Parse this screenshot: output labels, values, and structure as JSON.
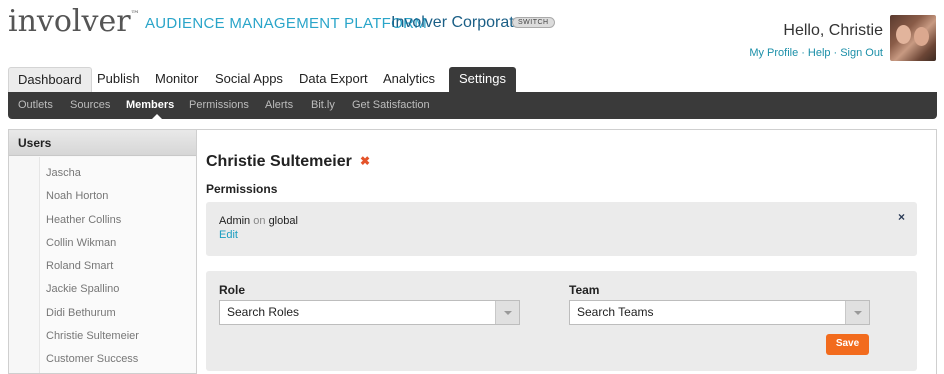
{
  "header": {
    "logo": "involver",
    "logo_tm": "™",
    "tagline": "AUDIENCE MANAGEMENT PLATFORM",
    "org_name": "Involver Corporate",
    "switch_label": "SWITCH",
    "greeting": "Hello, Christie",
    "links": [
      "My Profile",
      "Help",
      "Sign Out"
    ],
    "link_separator": "·"
  },
  "main_tabs": [
    "Dashboard",
    "Publish",
    "Monitor",
    "Social Apps",
    "Data Export",
    "Analytics",
    "Settings"
  ],
  "active_main_tab": "Settings",
  "sub_nav": [
    "Outlets",
    "Sources",
    "Members",
    "Permissions",
    "Alerts",
    "Bit.ly",
    "Get Satisfaction"
  ],
  "active_sub_nav": "Members",
  "users_panel": {
    "title": "Users",
    "users": [
      "Jascha",
      "Noah Horton",
      "Heather Collins",
      "Collin Wikman",
      "Roland Smart",
      "Jackie Spallino",
      "Didi Bethurum",
      "Christie Sultemeier",
      "Customer Success"
    ]
  },
  "content": {
    "user_name": "Christie Sultemeier",
    "delete_icon": "✖",
    "permissions_heading": "Permissions",
    "permission": {
      "role": "Admin",
      "connector": "on",
      "scope": "global",
      "edit_label": "Edit",
      "remove_icon": "×"
    },
    "form": {
      "role_label": "Role",
      "role_placeholder": "Search Roles",
      "team_label": "Team",
      "team_placeholder": "Search Teams",
      "save_label": "Save"
    }
  },
  "colors": {
    "accent_teal": "#2aa5c9",
    "nav_dark": "#3a3a3a",
    "save_orange": "#f26b1d",
    "delete_red": "#e4532a"
  }
}
